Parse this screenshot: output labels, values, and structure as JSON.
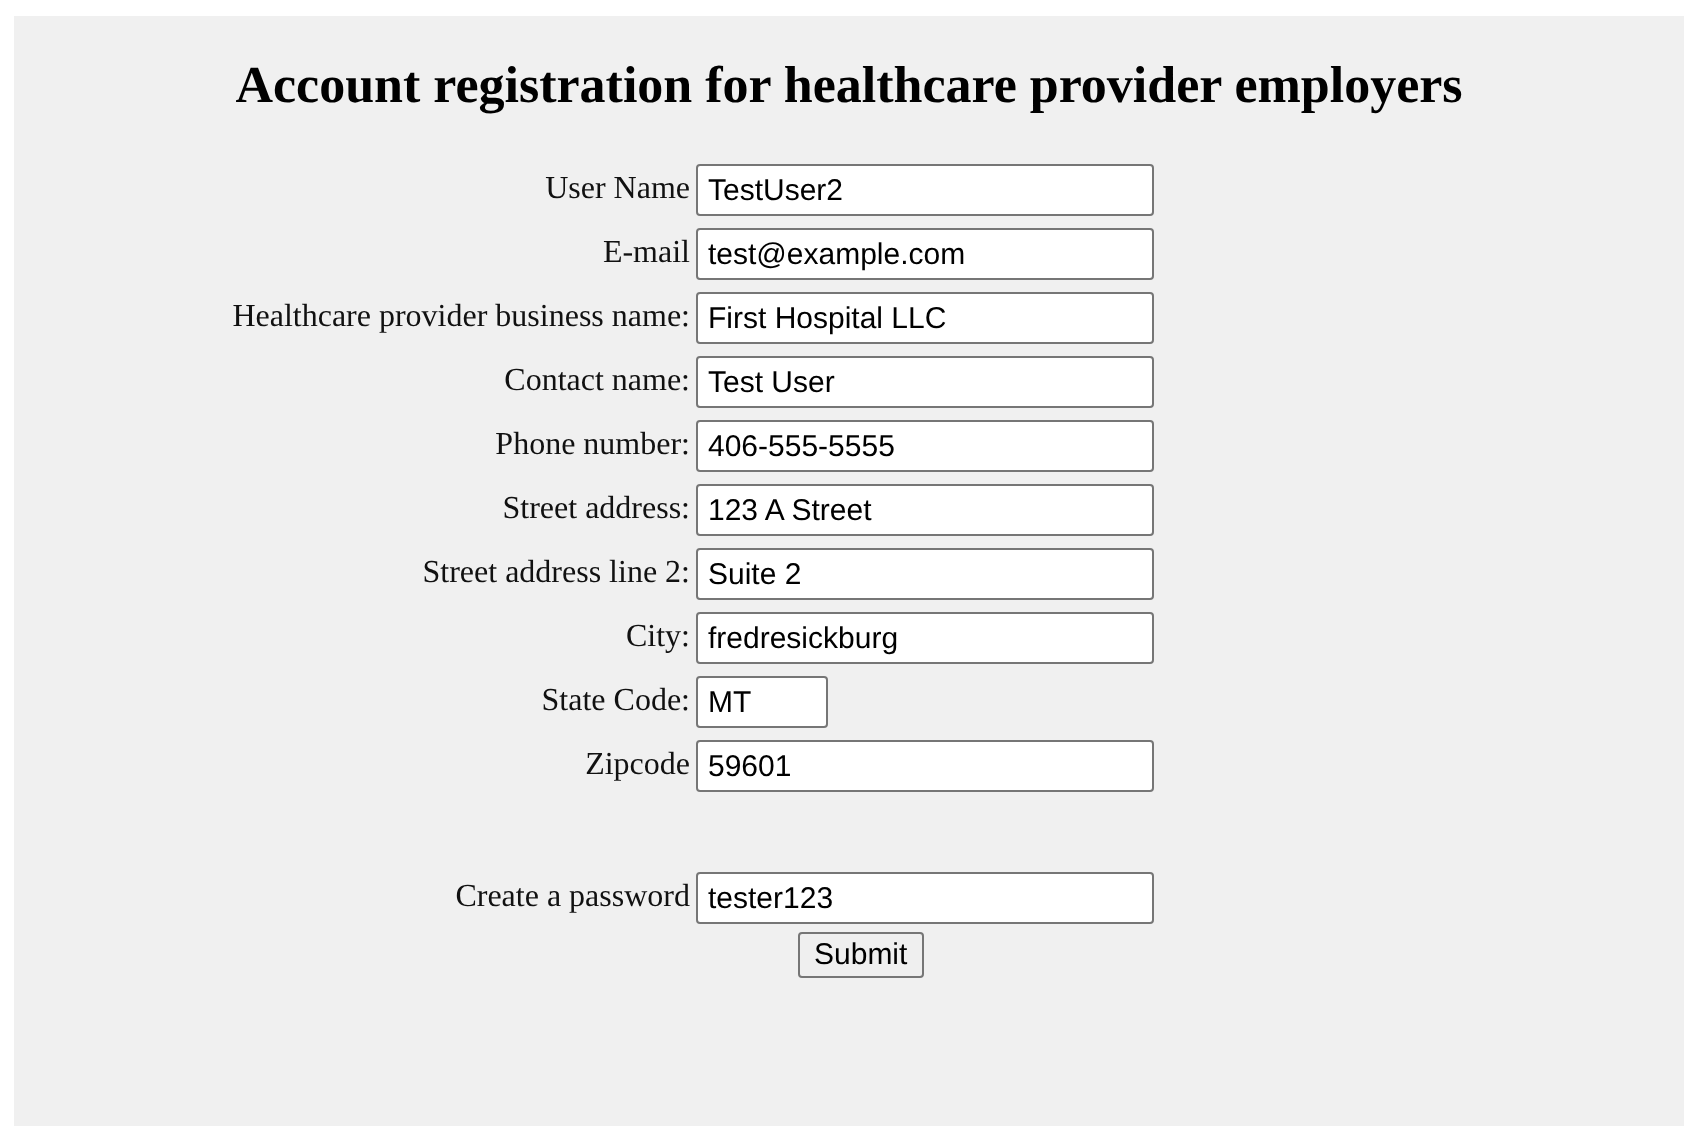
{
  "title": "Account registration for healthcare provider employers",
  "fields": [
    {
      "label": "User Name",
      "value": "TestUser2",
      "kind": "long"
    },
    {
      "label": "E-mail",
      "value": "test@example.com",
      "kind": "long"
    },
    {
      "label": "Healthcare provider business name:",
      "value": "First Hospital LLC",
      "kind": "long"
    },
    {
      "label": "Contact name:",
      "value": "Test User",
      "kind": "long"
    },
    {
      "label": "Phone number:",
      "value": "406-555-5555",
      "kind": "long"
    },
    {
      "label": "Street address:",
      "value": "123 A Street",
      "kind": "long"
    },
    {
      "label": "Street address line 2:",
      "value": "Suite 2",
      "kind": "long"
    },
    {
      "label": "City:",
      "value": "fredresickburg",
      "kind": "long"
    },
    {
      "label": "State Code:",
      "value": "MT",
      "kind": "short"
    },
    {
      "label": "Zipcode",
      "value": "59601",
      "kind": "long"
    }
  ],
  "password": {
    "label": "Create a password",
    "value": "tester123"
  },
  "submit": {
    "label": "Submit"
  }
}
